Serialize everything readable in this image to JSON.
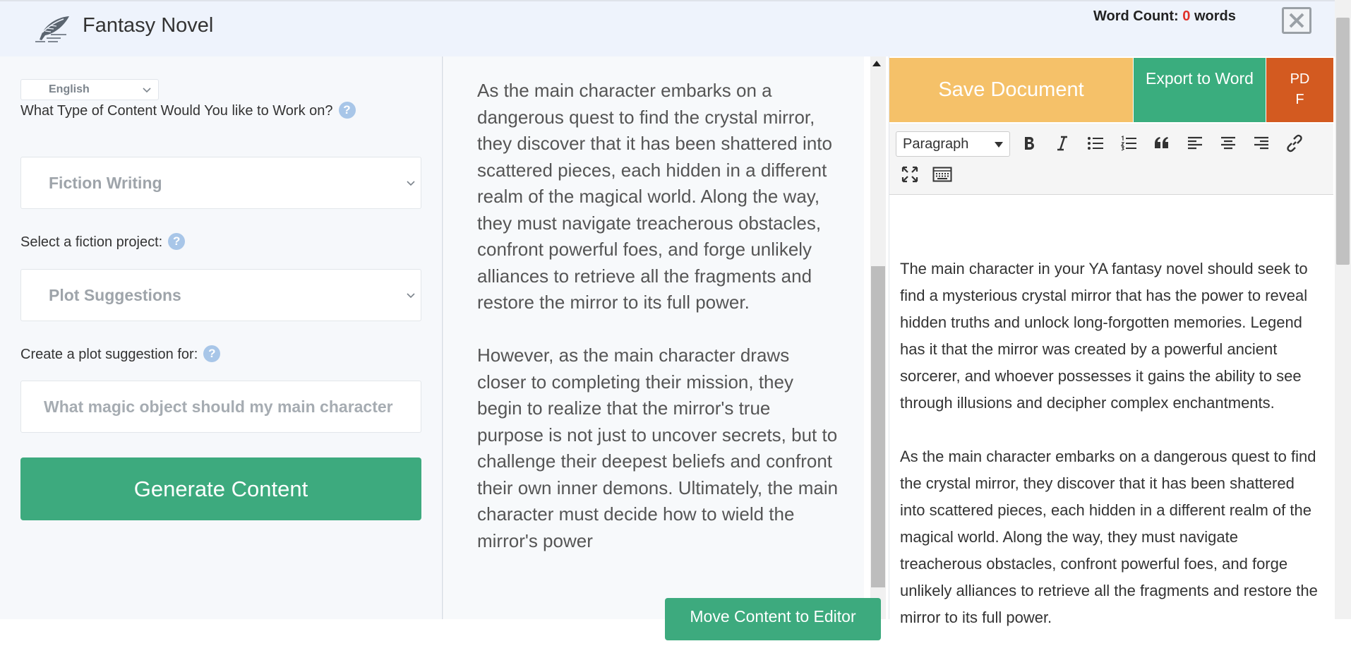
{
  "header": {
    "app_title": "Fantasy Novel",
    "word_count_label": "Word Count:",
    "word_count_value": "0",
    "word_count_unit": "words",
    "close_icon": "close-icon"
  },
  "left": {
    "language": "English",
    "content_type_label": "What Type of Content Would You like to Work on?",
    "content_type_value": "Fiction Writing",
    "project_label": "Select a fiction project:",
    "project_value": "Plot Suggestions",
    "plot_label": "Create a plot suggestion for:",
    "plot_placeholder": "What magic object should my main character seek?",
    "help_glyph": "?",
    "generate_label": "Generate Content"
  },
  "middle": {
    "paragraphs": [
      "As the main character embarks on a dangerous quest to find the crystal mirror, they discover that it has been shattered into scattered pieces, each hidden in a different realm of the magical world. Along the way, they must navigate treacherous obstacles, confront powerful foes, and forge unlikely alliances to retrieve all the fragments and restore the mirror to its full power.",
      "However, as the main character draws closer to completing their mission, they begin to realize that the mirror's true purpose is not just to uncover secrets, but to challenge their deepest beliefs and confront their own inner demons. Ultimately, the main character must decide how to wield the mirror's power"
    ],
    "move_label": "Move Content to Editor"
  },
  "editor": {
    "save_label": "Save Document",
    "export_label": "Export to Word",
    "pdf_label_1": "PD",
    "pdf_label_2": "F",
    "block_format": "Paragraph",
    "paragraphs": [
      "The main character in your YA fantasy novel should seek to find a mysterious crystal mirror that has the power to reveal hidden truths and unlock long-forgotten memories. Legend has it that the mirror was created by a powerful ancient sorcerer, and whoever possesses it gains the ability to see through illusions and decipher complex enchantments.",
      "As the main character embarks on a dangerous quest to find the crystal mirror, they discover that it has been shattered into scattered pieces, each hidden in a different realm of the magical world. Along the way, they must navigate treacherous obstacles, confront powerful foes, and forge unlikely alliances to retrieve all the fragments and restore the mirror to its full power."
    ]
  },
  "colors": {
    "green": "#3daa7e",
    "orange": "#f5c169",
    "pdf_red": "#d35a20",
    "count_red": "#e0312a"
  }
}
